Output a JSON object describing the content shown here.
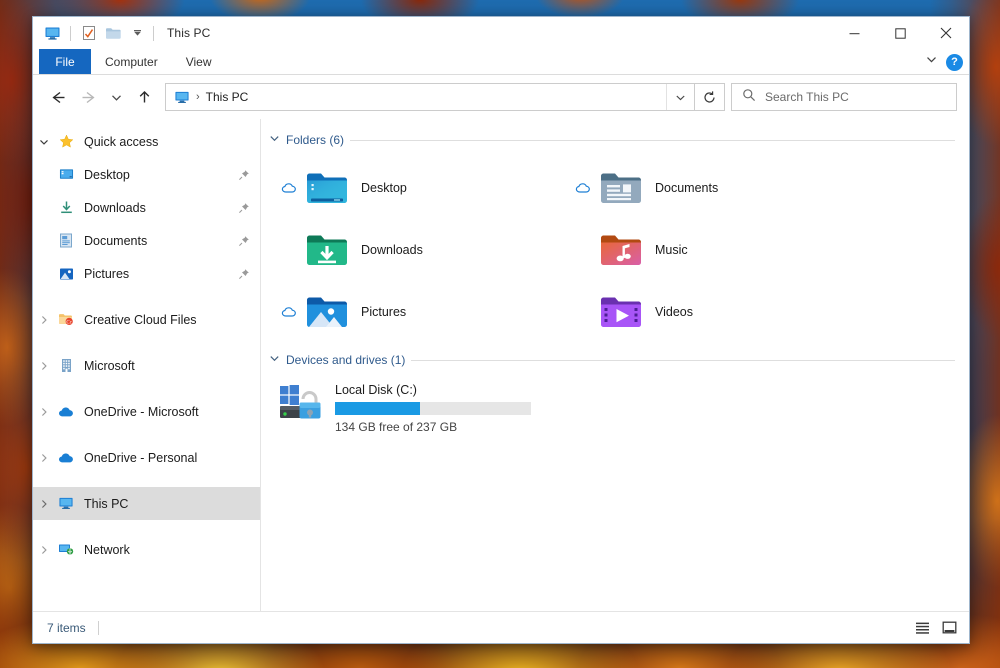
{
  "window": {
    "title": "This PC",
    "quick_access_toolbar": [
      {
        "name": "properties-icon",
        "label": "Properties"
      },
      {
        "name": "new-folder-icon",
        "label": "New folder"
      },
      {
        "name": "customize-qat-dropdown-icon",
        "label": "Customize Quick Access Toolbar"
      }
    ],
    "controls": {
      "minimize": "—",
      "maximize": "□",
      "close": "✕"
    }
  },
  "ribbon": {
    "tabs": [
      {
        "label": "File",
        "active": true
      },
      {
        "label": "Computer",
        "active": false
      },
      {
        "label": "View",
        "active": false
      }
    ],
    "expand_label": "⌄",
    "help_label": "?"
  },
  "navbar": {
    "back_label": "Back",
    "forward_label": "Forward",
    "recent_label": "Recent locations",
    "up_label": "Up",
    "breadcrumb": {
      "icon": "this-pc-icon",
      "separator": "›",
      "path": "This PC"
    },
    "dropdown_label": "⌄",
    "refresh_label": "↻"
  },
  "search": {
    "placeholder": "Search This PC",
    "value": "",
    "icon": "search-icon"
  },
  "sidebar": {
    "items": [
      {
        "label": "Quick access",
        "icon": "star-icon",
        "chevron": "expanded",
        "indent": 0,
        "pinned": false,
        "selected": false
      },
      {
        "label": "Desktop",
        "icon": "desktop-icon",
        "chevron": "none",
        "indent": 1,
        "pinned": true,
        "selected": false
      },
      {
        "label": "Downloads",
        "icon": "downloads-icon",
        "chevron": "none",
        "indent": 1,
        "pinned": true,
        "selected": false
      },
      {
        "label": "Documents",
        "icon": "documents-icon",
        "chevron": "none",
        "indent": 1,
        "pinned": true,
        "selected": false
      },
      {
        "label": "Pictures",
        "icon": "pictures-icon",
        "chevron": "none",
        "indent": 1,
        "pinned": true,
        "selected": false
      },
      {
        "label": "Creative Cloud Files",
        "icon": "creative-cloud-icon",
        "chevron": "collapsed",
        "indent": 0,
        "pinned": false,
        "selected": false
      },
      {
        "label": "Microsoft",
        "icon": "building-icon",
        "chevron": "collapsed",
        "indent": 0,
        "pinned": false,
        "selected": false
      },
      {
        "label": "OneDrive - Microsoft",
        "icon": "onedrive-icon",
        "chevron": "collapsed",
        "indent": 0,
        "pinned": false,
        "selected": false
      },
      {
        "label": "OneDrive - Personal",
        "icon": "onedrive-icon",
        "chevron": "collapsed",
        "indent": 0,
        "pinned": false,
        "selected": false
      },
      {
        "label": "This PC",
        "icon": "this-pc-icon",
        "chevron": "collapsed",
        "indent": 0,
        "pinned": false,
        "selected": true
      },
      {
        "label": "Network",
        "icon": "network-icon",
        "chevron": "collapsed",
        "indent": 0,
        "pinned": false,
        "selected": false
      }
    ]
  },
  "content": {
    "folders_group": {
      "title": "Folders (6)",
      "collapse_icon": "chevron-down-icon",
      "items": [
        {
          "label": "Desktop",
          "icon": "folder-desktop-icon",
          "cloud_status": "online-only"
        },
        {
          "label": "Documents",
          "icon": "folder-documents-icon",
          "cloud_status": "online-only"
        },
        {
          "label": "Downloads",
          "icon": "folder-downloads-icon",
          "cloud_status": "none"
        },
        {
          "label": "Music",
          "icon": "folder-music-icon",
          "cloud_status": "none"
        },
        {
          "label": "Pictures",
          "icon": "folder-pictures-icon",
          "cloud_status": "online-only"
        },
        {
          "label": "Videos",
          "icon": "folder-videos-icon",
          "cloud_status": "none"
        }
      ]
    },
    "drives_group": {
      "title": "Devices and drives (1)",
      "collapse_icon": "chevron-down-icon",
      "items": [
        {
          "label": "Local Disk (C:)",
          "icon": "local-disk-bitlocker-icon",
          "capacity_text": "134 GB free of 237 GB",
          "free_gb": 134,
          "total_gb": 237,
          "used_percent": 43,
          "bar_color": "#1a9ae4",
          "bar_track_color": "#e6e6e6"
        }
      ]
    }
  },
  "statusbar": {
    "item_count": "7 items",
    "views": [
      {
        "name": "details-view-button",
        "label": "Details view"
      },
      {
        "name": "large-icons-view-button",
        "label": "Large icons view"
      }
    ]
  },
  "colors": {
    "accent": "#1567c0",
    "selection": "#dcdcdc",
    "group_header": "#2f5a8c",
    "help_blue": "#1a8ae5"
  }
}
